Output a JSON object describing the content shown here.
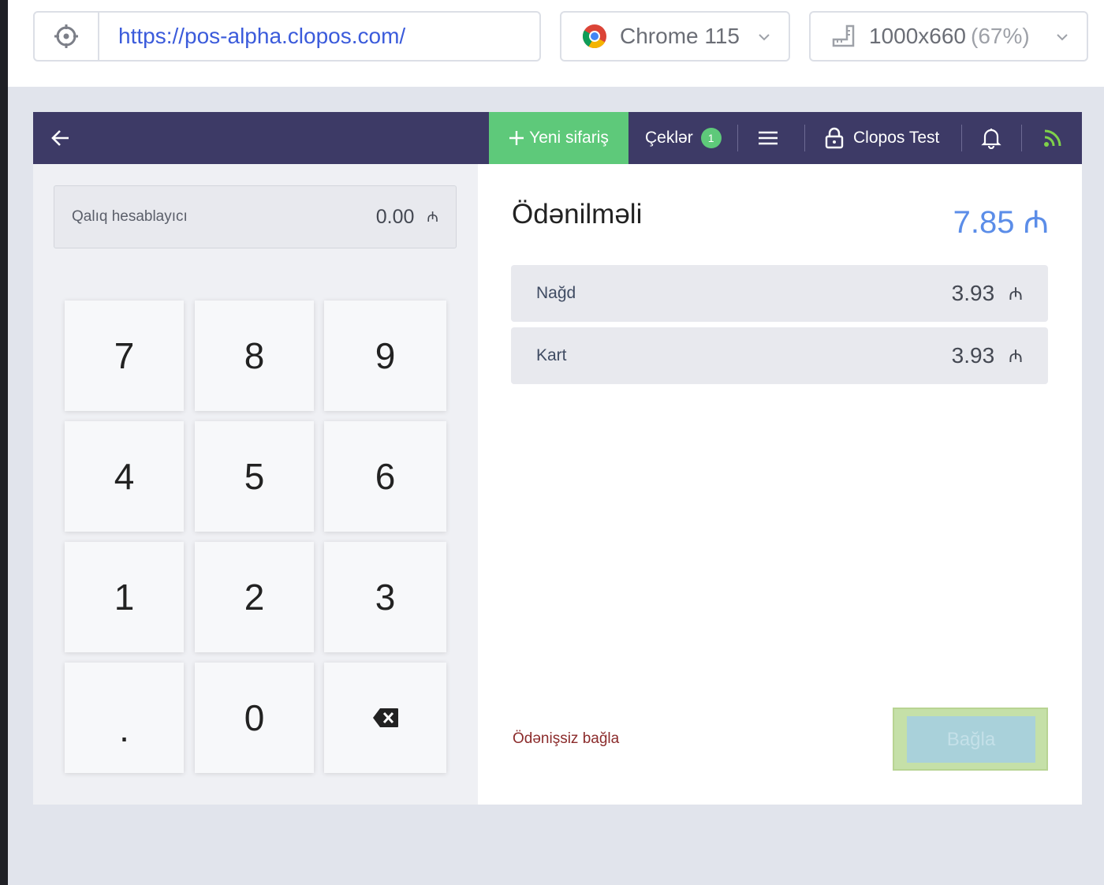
{
  "browser_bar": {
    "url": "https://pos-alpha.clopos.com/",
    "browser": "Chrome 115",
    "viewport": "1000x660",
    "zoom": "(67%)"
  },
  "navbar": {
    "new_order": "Yeni sifariş",
    "checks_label": "Çeklər",
    "checks_count": "1",
    "user": "Clopos Test"
  },
  "change_calculator": {
    "label": "Qalıq hesablayıcı",
    "value": "0.00",
    "currency": "₼"
  },
  "keypad": [
    "7",
    "8",
    "9",
    "4",
    "5",
    "6",
    "1",
    "2",
    "3",
    ".",
    "0",
    "backspace"
  ],
  "payment": {
    "due_label": "Ödənilməli",
    "due_value": "7.85 ₼",
    "rows": [
      {
        "name": "Nağd",
        "amount": "3.93",
        "currency": "₼"
      },
      {
        "name": "Kart",
        "amount": "3.93",
        "currency": "₼"
      }
    ],
    "free_close": "Ödənişsiz bağla",
    "close_button": "Bağla"
  },
  "colors": {
    "navbar": "#3d3a66",
    "accent_green": "#5ec97a",
    "due_blue": "#5b8de8"
  }
}
